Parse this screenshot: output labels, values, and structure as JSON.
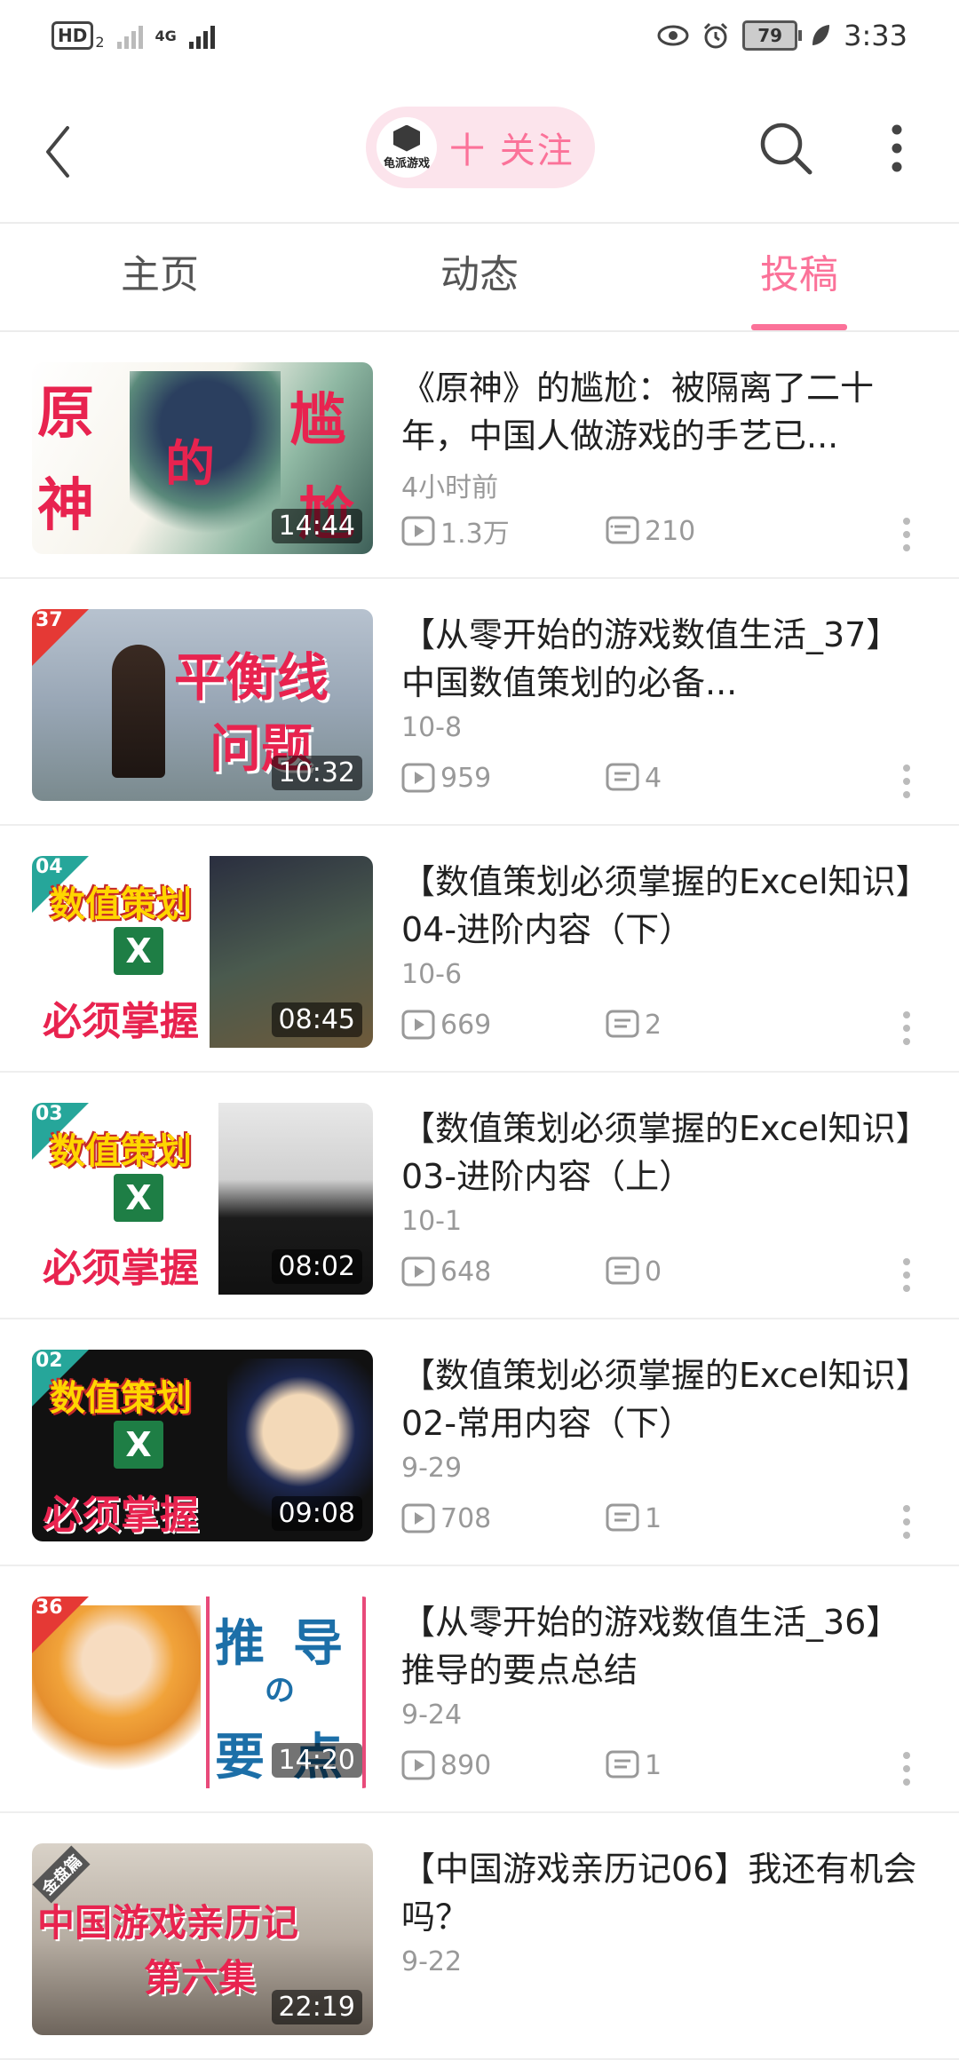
{
  "status_bar": {
    "hd": "HD",
    "hd_sub": "2",
    "network": "4G",
    "battery": "79",
    "time": "3:33"
  },
  "header": {
    "follow_label": "十 关注",
    "avatar_text": "龟派游戏"
  },
  "tabs": [
    {
      "label": "主页",
      "active": false
    },
    {
      "label": "动态",
      "active": false
    },
    {
      "label": "投稿",
      "active": true
    }
  ],
  "videos": [
    {
      "title": "《原神》的尴尬：被隔离了二十年，中国人做游戏的手艺已...",
      "date": "4小时前",
      "views": "1.3万",
      "comments": "210",
      "duration": "14:44"
    },
    {
      "title": "【从零开始的游戏数值生活_37】中国数值策划的必备...",
      "date": "10-8",
      "views": "959",
      "comments": "4",
      "duration": "10:32",
      "badge": "37"
    },
    {
      "title": "【数值策划必须掌握的Excel知识】04-进阶内容（下）",
      "date": "10-6",
      "views": "669",
      "comments": "2",
      "duration": "08:45",
      "badge": "04"
    },
    {
      "title": "【数值策划必须掌握的Excel知识】03-进阶内容（上）",
      "date": "10-1",
      "views": "648",
      "comments": "0",
      "duration": "08:02",
      "badge": "03"
    },
    {
      "title": "【数值策划必须掌握的Excel知识】02-常用内容（下）",
      "date": "9-29",
      "views": "708",
      "comments": "1",
      "duration": "09:08",
      "badge": "02"
    },
    {
      "title": "【从零开始的游戏数值生活_36】推导的要点总结",
      "date": "9-24",
      "views": "890",
      "comments": "1",
      "duration": "14:20",
      "badge": "36"
    },
    {
      "title": "【中国游戏亲历记06】我还有机会吗？",
      "date": "9-22",
      "views": "",
      "comments": "",
      "duration": "22:19"
    }
  ],
  "thumb_text": {
    "v1": [
      "原",
      "神",
      "尴",
      "尬",
      "的"
    ],
    "v2": [
      "平衡线",
      "问题"
    ],
    "excel": [
      "数值策划",
      "必须掌握",
      "X"
    ],
    "v6": [
      "推",
      "导",
      "の",
      "要",
      "点"
    ],
    "v7": [
      "金盘篇",
      "中国游戏亲历记",
      "第六集"
    ]
  },
  "colors": {
    "accent": "#fb7299",
    "accent_bg": "#fce4ec",
    "meta_gray": "#999999"
  },
  "icons": [
    "back-arrow-icon",
    "search-icon",
    "more-vertical-icon",
    "play-count-icon",
    "comment-count-icon"
  ]
}
